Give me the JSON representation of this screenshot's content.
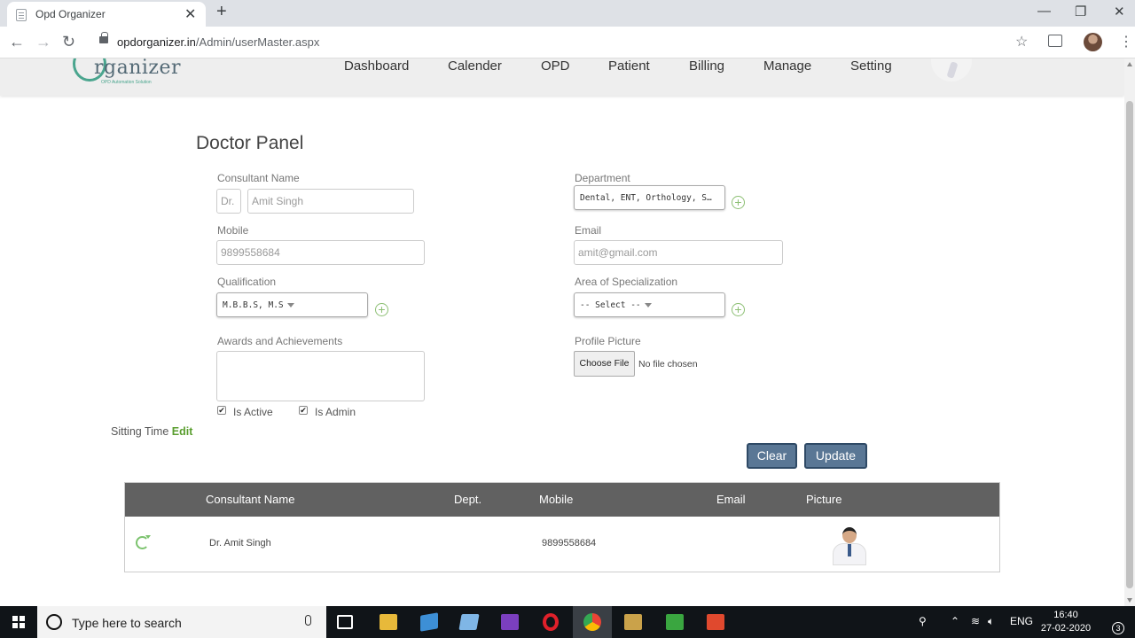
{
  "browser": {
    "tab_title": "Opd Organizer",
    "tab_close": "✕",
    "new_tab": "+",
    "minimize": "—",
    "maximize": "❐",
    "close": "✕",
    "back": "←",
    "forward": "→",
    "reload": "↻",
    "url_host": "opdorganizer.in",
    "url_path": "/Admin/userMaster.aspx",
    "star": "☆",
    "menu": "⋮"
  },
  "site": {
    "logo_text": "rganizer",
    "logo_sub": "OPD Automation Solution",
    "nav": [
      "Dashboard",
      "Calender",
      "OPD",
      "Patient",
      "Billing",
      "Manage",
      "Setting"
    ]
  },
  "form": {
    "title": "Doctor Panel",
    "consultant_label": "Consultant Name",
    "prefix_placeholder": "Dr.",
    "name_placeholder": "Amit Singh",
    "department_label": "Department",
    "department_value": "Dental, ENT, Orthology, S…",
    "mobile_label": "Mobile",
    "mobile_placeholder": "9899558684",
    "email_label": "Email",
    "email_placeholder": "amit@gmail.com",
    "qualification_label": "Qualification",
    "qualification_value": "M.B.B.S, M.S",
    "specialization_label": "Area of Specialization",
    "specialization_value": "-- Select --",
    "awards_label": "Awards and Achievements",
    "profile_label": "Profile Picture",
    "choose_file": "Choose File",
    "no_file": "No file chosen",
    "is_active": "Is Active",
    "is_admin": "Is Admin",
    "is_active_checked": true,
    "is_admin_checked": true,
    "sitting_time": "Sitting Time",
    "edit_link": "Edit",
    "clear_btn": "Clear",
    "update_btn": "Update",
    "accent_green": "#5a9e2f",
    "button_color": "#5a7795"
  },
  "table": {
    "headers": [
      "Consultant Name",
      "Dept.",
      "Mobile",
      "Email",
      "Picture"
    ],
    "rows": [
      {
        "name": "Dr. Amit Singh",
        "dept": "",
        "mobile": "9899558684",
        "email": ""
      }
    ],
    "header_color": "#616161"
  },
  "taskbar": {
    "search_text": "Type here to search",
    "lang": "ENG",
    "time": "16:40",
    "date": "27-02-2020",
    "notifications": "3"
  }
}
